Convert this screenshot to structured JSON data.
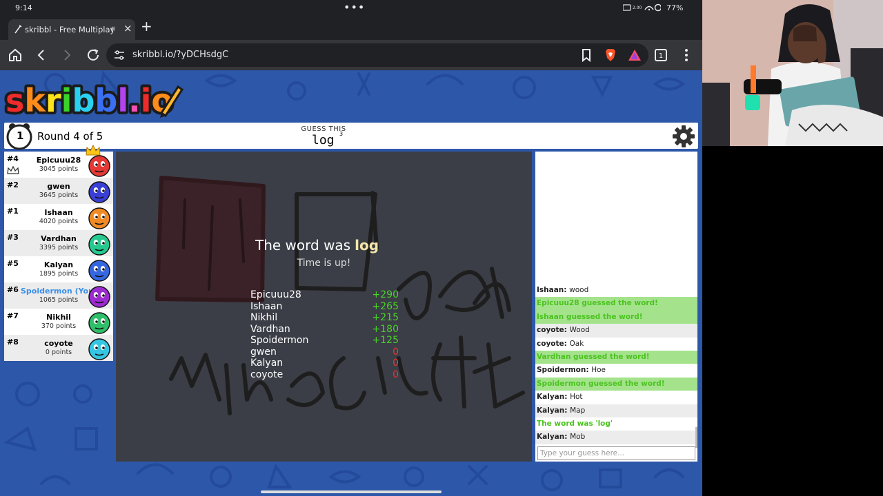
{
  "status_bar": {
    "time": "9:14",
    "battery": "77%"
  },
  "browser": {
    "tab_title": "skribbl - Free Multiplayer",
    "url": "skribbl.io/?yDCHsdgC"
  },
  "game": {
    "logo_text": "skribbl.io",
    "round_timer": "1",
    "round_label": "Round 4 of 5",
    "hint_label": "GUESS THIS",
    "word": "log",
    "word_length": "3"
  },
  "players": [
    {
      "rank": "#4",
      "name": "Epicuuu28",
      "points": "3045 points",
      "avatar_color": "#e53935",
      "is_you": false
    },
    {
      "rank": "#2",
      "name": "gwen",
      "points": "3645 points",
      "avatar_color": "#3a3fd6",
      "is_you": false
    },
    {
      "rank": "#1",
      "name": "Ishaan",
      "points": "4020 points",
      "avatar_color": "#f08a24",
      "is_you": false
    },
    {
      "rank": "#3",
      "name": "Vardhan",
      "points": "3395 points",
      "avatar_color": "#25c98f",
      "is_you": false
    },
    {
      "rank": "#5",
      "name": "Kalyan",
      "points": "1895 points",
      "avatar_color": "#3567e0",
      "is_you": false
    },
    {
      "rank": "#6",
      "name": "Spoidermon (You)",
      "points": "1065 points",
      "avatar_color": "#9c2bd1",
      "is_you": true
    },
    {
      "rank": "#7",
      "name": "Nikhil",
      "points": "370 points",
      "avatar_color": "#2fbf6a",
      "is_you": false
    },
    {
      "rank": "#8",
      "name": "coyote",
      "points": "0 points",
      "avatar_color": "#35c6e3",
      "is_you": false
    }
  ],
  "overlay": {
    "title_prefix": "The word was",
    "word": "log",
    "subtitle": "Time is up!",
    "results": [
      {
        "name": "Epicuuu28",
        "score": "+290",
        "color": "#4bd32a"
      },
      {
        "name": "Ishaan",
        "score": "+265",
        "color": "#4bd32a"
      },
      {
        "name": "Nikhil",
        "score": "+215",
        "color": "#4bd32a"
      },
      {
        "name": "Vardhan",
        "score": "+180",
        "color": "#4bd32a"
      },
      {
        "name": "Spoidermon",
        "score": "+125",
        "color": "#4bd32a"
      },
      {
        "name": "gwen",
        "score": "0",
        "color": "#e53935"
      },
      {
        "name": "Kalyan",
        "score": "0",
        "color": "#e53935"
      },
      {
        "name": "coyote",
        "score": "0",
        "color": "#e53935"
      }
    ]
  },
  "chat": {
    "messages": [
      {
        "author": "Ishaan",
        "text": "wood",
        "style": "plain"
      },
      {
        "author": "",
        "text": "Epicuuu28 guessed the word!",
        "style": "green"
      },
      {
        "author": "",
        "text": "Ishaan guessed the word!",
        "style": "green"
      },
      {
        "author": "coyote",
        "text": "Wood",
        "style": "alt"
      },
      {
        "author": "coyote",
        "text": "Oak",
        "style": "plain"
      },
      {
        "author": "",
        "text": "Vardhan guessed the word!",
        "style": "green"
      },
      {
        "author": "Spoidermon",
        "text": "Hoe",
        "style": "plain"
      },
      {
        "author": "",
        "text": "Spoidermon guessed the word!",
        "style": "green"
      },
      {
        "author": "Kalyan",
        "text": "Hot",
        "style": "plain"
      },
      {
        "author": "Kalyan",
        "text": "Map",
        "style": "alt"
      },
      {
        "author": "",
        "text": "The word was 'log'",
        "style": "plain-green"
      },
      {
        "author": "Kalyan",
        "text": "Mob",
        "style": "alt"
      }
    ],
    "input_placeholder": "Type your guess here..."
  }
}
